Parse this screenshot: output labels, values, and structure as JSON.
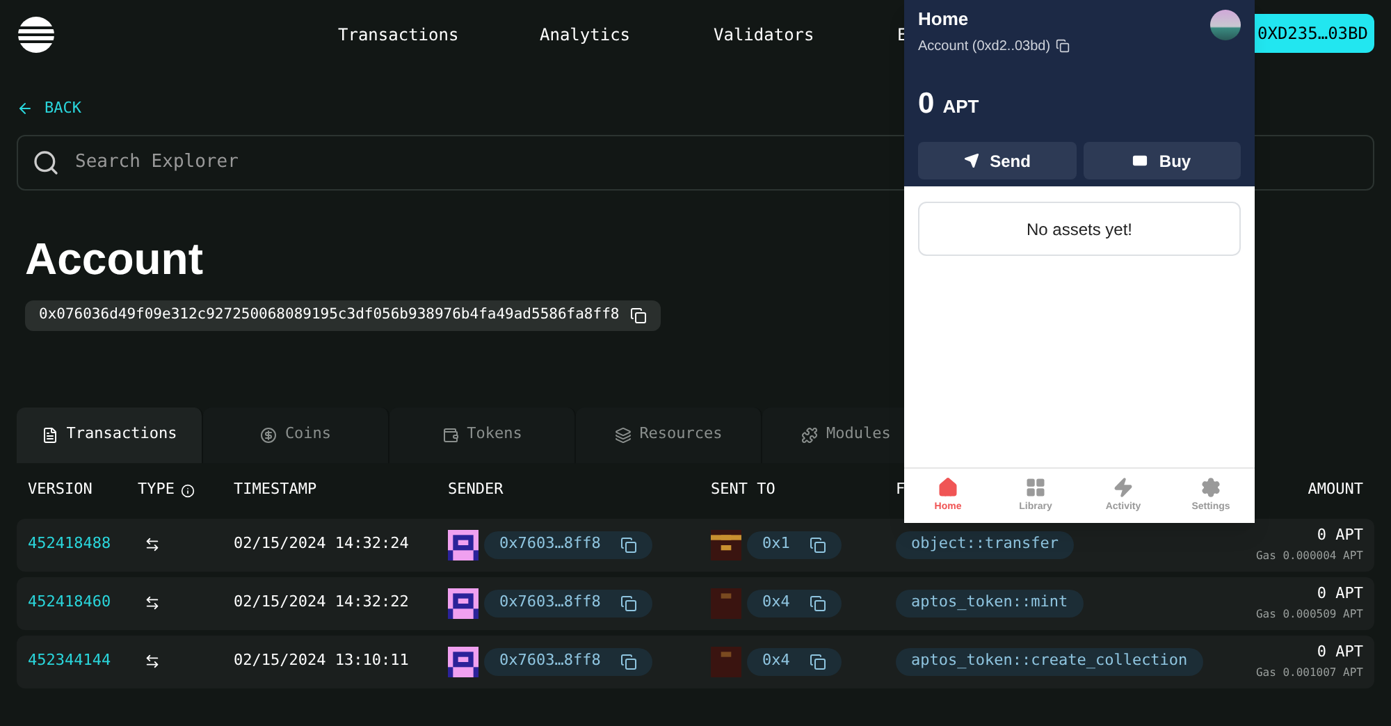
{
  "nav": {
    "items": [
      "Transactions",
      "Analytics",
      "Validators",
      "E"
    ],
    "wallet_button": "0XD235…03BD"
  },
  "back_link": "BACK",
  "search": {
    "placeholder": "Search Explorer"
  },
  "account": {
    "title": "Account",
    "address": "0x076036d49f09e312c927250068089195c3df056b938976b4fa49ad5586fa8ff8"
  },
  "tabs": [
    {
      "label": "Transactions",
      "selected": true
    },
    {
      "label": "Coins",
      "selected": false
    },
    {
      "label": "Tokens",
      "selected": false
    },
    {
      "label": "Resources",
      "selected": false
    },
    {
      "label": "Modules",
      "selected": false
    }
  ],
  "table": {
    "columns": [
      "VERSION",
      "TYPE",
      "TIMESTAMP",
      "SENDER",
      "SENT TO",
      "F",
      "AMOUNT"
    ],
    "rows": [
      {
        "version": "452418488",
        "timestamp": "02/15/2024 14:32:24",
        "sender": "0x7603…8ff8",
        "sent_to": "0x1",
        "function": "object::transfer",
        "amount": "0 APT",
        "gas": "Gas 0.000004 APT"
      },
      {
        "version": "452418460",
        "timestamp": "02/15/2024 14:32:22",
        "sender": "0x7603…8ff8",
        "sent_to": "0x4",
        "function": "aptos_token::mint",
        "amount": "0 APT",
        "gas": "Gas 0.000509 APT"
      },
      {
        "version": "452344144",
        "timestamp": "02/15/2024 13:10:11",
        "sender": "0x7603…8ff8",
        "sent_to": "0x4",
        "function": "aptos_token::create_collection",
        "amount": "0 APT",
        "gas": "Gas 0.001007 APT"
      }
    ]
  },
  "wallet_popup": {
    "title": "Home",
    "account": "Account (0xd2..03bd)",
    "balance": "0",
    "unit": "APT",
    "buttons": [
      {
        "label": "Send"
      },
      {
        "label": "Buy"
      }
    ],
    "empty_message": "No assets yet!",
    "bottom_nav": [
      {
        "label": "Home",
        "selected": true
      },
      {
        "label": "Library",
        "selected": false
      },
      {
        "label": "Activity",
        "selected": false
      },
      {
        "label": "Settings",
        "selected": false
      }
    ]
  }
}
